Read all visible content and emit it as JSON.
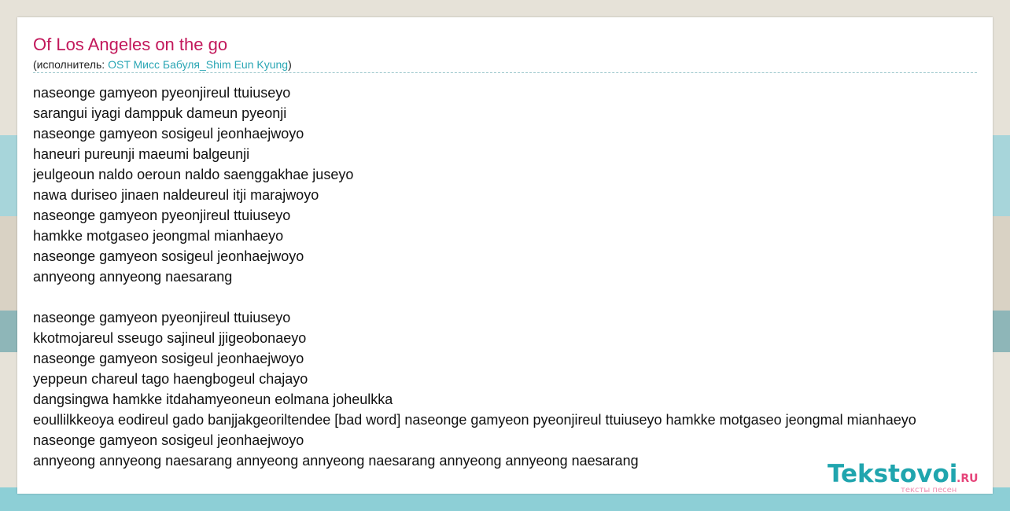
{
  "song": {
    "title": "Of Los Angeles on the go",
    "artist_prefix": "(исполнитель: ",
    "artist": "OST Мисс Бабуля_Shim Eun Kyung",
    "artist_suffix": ")"
  },
  "lyrics": [
    "naseonge gamyeon pyeonjireul ttuiuseyo",
    "sarangui iyagi damppuk dameun pyeonji",
    "naseonge gamyeon sosigeul jeonhaejwoyo",
    "haneuri pureunji maeumi balgeunji",
    "jeulgeoun naldo oeroun naldo saenggakhae juseyo",
    "nawa duriseo jinaen naldeureul itji marajwoyo",
    "naseonge gamyeon pyeonjireul ttuiuseyo",
    "hamkke motgaseo jeongmal mianhaeyo",
    "naseonge gamyeon sosigeul jeonhaejwoyo",
    "annyeong annyeong naesarang",
    "",
    "naseonge gamyeon pyeonjireul ttuiuseyo",
    "kkotmojareul sseugo sajineul jjigeobonaeyo",
    "naseonge gamyeon sosigeul jeonhaejwoyo",
    "yeppeun chareul tago haengbogeul chajayo",
    "dangsingwa hamkke itdahamyeoneun eolmana joheulkka",
    "eoullilkkeoya eodireul gado banjjakgeoriltendee [bad word] naseonge gamyeon pyeonjireul ttuiuseyo hamkke motgaseo jeongmal mianhaeyo",
    "naseonge gamyeon sosigeul jeonhaejwoyo",
    "annyeong annyeong naesarang annyeong annyeong naesarang annyeong annyeong naesarang"
  ],
  "logo": {
    "name": "Tekstovoi",
    "tld": ".RU",
    "tagline": "тексты песен"
  },
  "colors": {
    "title": "#c2185b",
    "link": "#2aa6b4",
    "logo": "#20a5ae",
    "logo_accent": "#e6457a"
  }
}
